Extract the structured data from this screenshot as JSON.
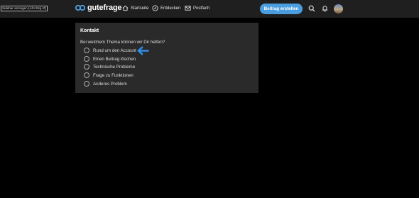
{
  "tooltip": {
    "text": "Sidebar anzeigen (Alt+Strg+Z)"
  },
  "brand": {
    "name": "gutefrage",
    "color": "#4a9ee0"
  },
  "nav": {
    "home": {
      "label": "Startseite",
      "icon": "home-icon"
    },
    "discover": {
      "label": "Entdecken",
      "icon": "compass-icon"
    },
    "mail": {
      "label": "Postfach",
      "icon": "mail-icon"
    }
  },
  "actions": {
    "create_label": "Beitrag erstellen",
    "search_icon": "search-icon",
    "bell_icon": "bell-icon",
    "avatar": "user-avatar"
  },
  "contact": {
    "title": "Kontakt",
    "question": "Bei welchem Thema können wir Dir helfen?",
    "options": [
      "Rund um den Account",
      "Einen Beitrag löschen",
      "Technische Probleme",
      "Frage zu Funktionen",
      "Anderes Problem"
    ],
    "highlight_arrow": "arrow-left-icon",
    "arrow_color": "#2f8fe8"
  }
}
